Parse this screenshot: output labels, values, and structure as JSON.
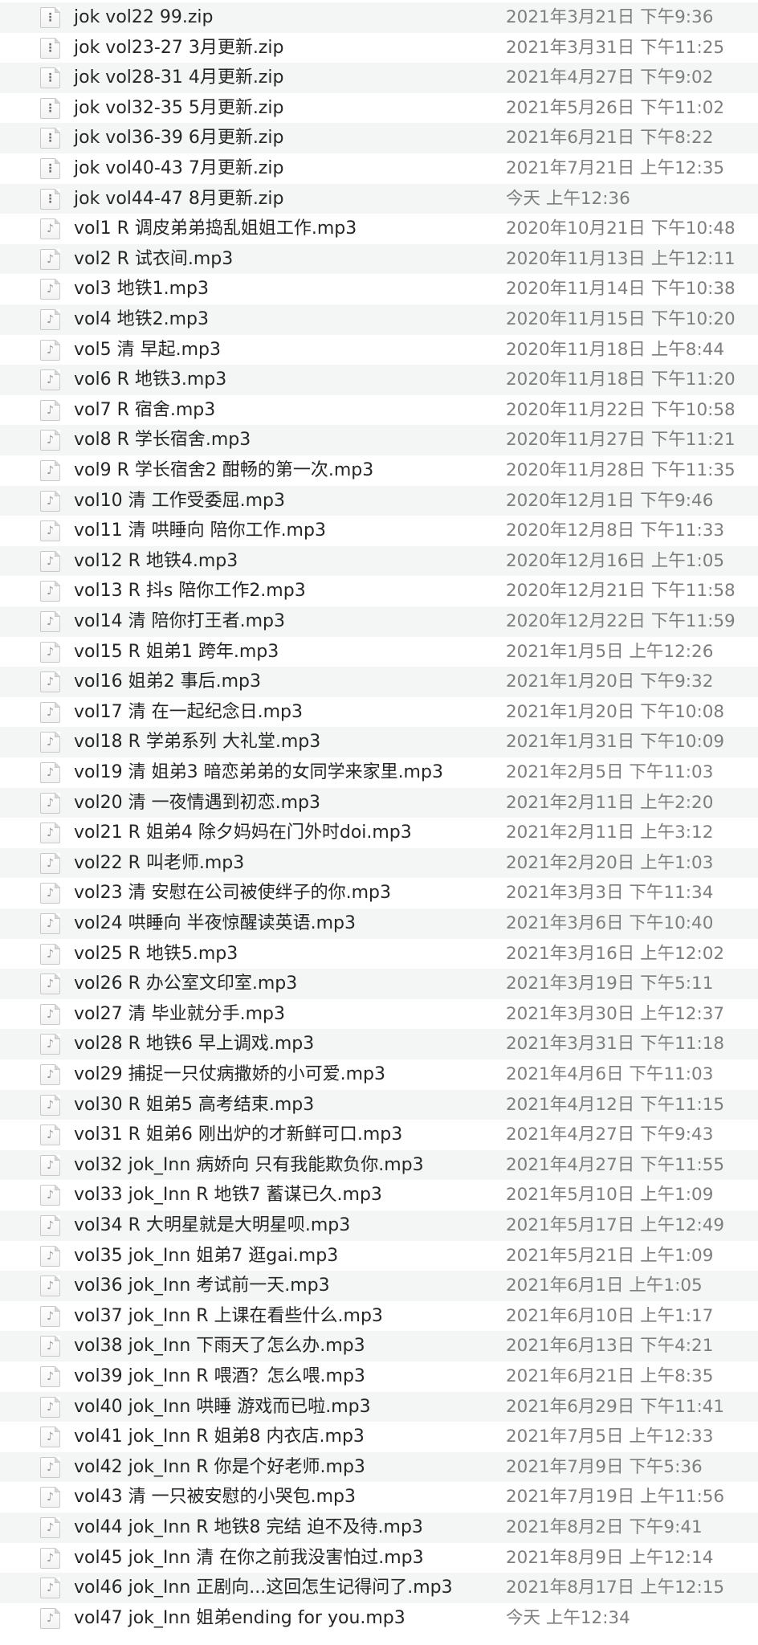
{
  "icons": {
    "zip": "zip-file-icon",
    "audio": "mp3-file-icon"
  },
  "files": [
    {
      "name": "jok vol22 99.zip",
      "date": "2021年3月21日 下午9:36",
      "type": "zip"
    },
    {
      "name": "jok vol23-27 3月更新.zip",
      "date": "2021年3月31日 下午11:25",
      "type": "zip"
    },
    {
      "name": "jok vol28-31 4月更新.zip",
      "date": "2021年4月27日 下午9:02",
      "type": "zip"
    },
    {
      "name": "jok vol32-35 5月更新.zip",
      "date": "2021年5月26日 下午11:02",
      "type": "zip"
    },
    {
      "name": "jok vol36-39 6月更新.zip",
      "date": "2021年6月21日 下午8:22",
      "type": "zip"
    },
    {
      "name": "jok vol40-43 7月更新.zip",
      "date": "2021年7月21日 上午12:35",
      "type": "zip"
    },
    {
      "name": "jok vol44-47 8月更新.zip",
      "date": "今天 上午12:36",
      "type": "zip"
    },
    {
      "name": "vol1 R 调皮弟弟捣乱姐姐工作.mp3",
      "date": "2020年10月21日 下午10:48",
      "type": "mp3"
    },
    {
      "name": "vol2 R 试衣间.mp3",
      "date": "2020年11月13日 上午12:11",
      "type": "mp3"
    },
    {
      "name": "vol3 地铁1.mp3",
      "date": "2020年11月14日 下午10:38",
      "type": "mp3"
    },
    {
      "name": "vol4 地铁2.mp3",
      "date": "2020年11月15日 下午10:20",
      "type": "mp3"
    },
    {
      "name": "vol5 清 早起.mp3",
      "date": "2020年11月18日 上午8:44",
      "type": "mp3"
    },
    {
      "name": "vol6 R 地铁3.mp3",
      "date": "2020年11月18日 下午11:20",
      "type": "mp3"
    },
    {
      "name": "vol7 R 宿舍.mp3",
      "date": "2020年11月22日 下午10:58",
      "type": "mp3"
    },
    {
      "name": "vol8 R 学长宿舍.mp3",
      "date": "2020年11月27日 下午11:21",
      "type": "mp3"
    },
    {
      "name": "vol9 R 学长宿舍2 酣畅的第一次.mp3",
      "date": "2020年11月28日 下午11:35",
      "type": "mp3"
    },
    {
      "name": "vol10 清 工作受委屈.mp3",
      "date": "2020年12月1日 下午9:46",
      "type": "mp3"
    },
    {
      "name": "vol11 清 哄睡向 陪你工作.mp3",
      "date": "2020年12月8日 下午11:33",
      "type": "mp3"
    },
    {
      "name": "vol12 R 地铁4.mp3",
      "date": "2020年12月16日 上午1:05",
      "type": "mp3"
    },
    {
      "name": "vol13 R 抖s 陪你工作2.mp3",
      "date": "2020年12月21日 下午11:58",
      "type": "mp3"
    },
    {
      "name": "vol14 清 陪你打王者.mp3",
      "date": "2020年12月22日 下午11:59",
      "type": "mp3"
    },
    {
      "name": "vol15 R 姐弟1 跨年.mp3",
      "date": "2021年1月5日 上午12:26",
      "type": "mp3"
    },
    {
      "name": "vol16 姐弟2 事后.mp3",
      "date": "2021年1月20日 下午9:32",
      "type": "mp3"
    },
    {
      "name": "vol17 清 在一起纪念日.mp3",
      "date": "2021年1月20日 下午10:08",
      "type": "mp3"
    },
    {
      "name": "vol18 R 学弟系列 大礼堂.mp3",
      "date": "2021年1月31日 下午10:09",
      "type": "mp3"
    },
    {
      "name": "vol19 清 姐弟3 暗恋弟弟的女同学来家里.mp3",
      "date": "2021年2月5日 下午11:03",
      "type": "mp3"
    },
    {
      "name": "vol20 清 一夜情遇到初恋.mp3",
      "date": "2021年2月11日 上午2:20",
      "type": "mp3"
    },
    {
      "name": "vol21 R 姐弟4 除夕妈妈在门外时doi.mp3",
      "date": "2021年2月11日 上午3:12",
      "type": "mp3"
    },
    {
      "name": "vol22 R 叫老师.mp3",
      "date": "2021年2月20日 上午1:03",
      "type": "mp3"
    },
    {
      "name": "vol23 清 安慰在公司被使绊子的你.mp3",
      "date": "2021年3月3日 下午11:34",
      "type": "mp3"
    },
    {
      "name": "vol24 哄睡向 半夜惊醒读英语.mp3",
      "date": "2021年3月6日 下午10:40",
      "type": "mp3"
    },
    {
      "name": "vol25 R 地铁5.mp3",
      "date": "2021年3月16日 上午12:02",
      "type": "mp3"
    },
    {
      "name": "vol26 R 办公室文印室.mp3",
      "date": "2021年3月19日 下午5:11",
      "type": "mp3"
    },
    {
      "name": "vol27 清 毕业就分手.mp3",
      "date": "2021年3月30日 上午12:37",
      "type": "mp3"
    },
    {
      "name": "vol28 R 地铁6 早上调戏.mp3",
      "date": "2021年3月31日 下午11:18",
      "type": "mp3"
    },
    {
      "name": "vol29 捕捉一只仗病撒娇的小可爱.mp3",
      "date": "2021年4月6日 下午11:03",
      "type": "mp3"
    },
    {
      "name": "vol30 R 姐弟5 高考结束.mp3",
      "date": "2021年4月12日 下午11:15",
      "type": "mp3"
    },
    {
      "name": "vol31 R 姐弟6 刚出炉的才新鲜可口.mp3",
      "date": "2021年4月27日 下午9:43",
      "type": "mp3"
    },
    {
      "name": "vol32 jok_Inn 病娇向 只有我能欺负你.mp3",
      "date": "2021年4月27日 下午11:55",
      "type": "mp3"
    },
    {
      "name": "vol33 jok_Inn R 地铁7 蓄谋已久.mp3",
      "date": "2021年5月10日 上午1:09",
      "type": "mp3"
    },
    {
      "name": "vol34 R 大明星就是大明星呗.mp3",
      "date": "2021年5月17日 上午12:49",
      "type": "mp3"
    },
    {
      "name": "vol35 jok_Inn 姐弟7 逛gai.mp3",
      "date": "2021年5月21日 上午1:09",
      "type": "mp3"
    },
    {
      "name": "vol36 jok_Inn 考试前一天.mp3",
      "date": "2021年6月1日 上午1:05",
      "type": "mp3"
    },
    {
      "name": "vol37 jok_Inn R 上课在看些什么.mp3",
      "date": "2021年6月10日 上午1:17",
      "type": "mp3"
    },
    {
      "name": "vol38 jok_Inn 下雨天了怎么办.mp3",
      "date": "2021年6月13日 下午4:21",
      "type": "mp3"
    },
    {
      "name": "vol39 jok_Inn R 喂酒？怎么喂.mp3",
      "date": "2021年6月21日 上午8:35",
      "type": "mp3"
    },
    {
      "name": "vol40 jok_Inn 哄睡 游戏而已啦.mp3",
      "date": "2021年6月29日 下午11:41",
      "type": "mp3"
    },
    {
      "name": "vol41 jok_Inn R 姐弟8 内衣店.mp3",
      "date": "2021年7月5日 上午12:33",
      "type": "mp3"
    },
    {
      "name": "vol42 jok_Inn R 你是个好老师.mp3",
      "date": "2021年7月9日 下午5:36",
      "type": "mp3"
    },
    {
      "name": "vol43 清 一只被安慰的小哭包.mp3",
      "date": "2021年7月19日 上午11:56",
      "type": "mp3"
    },
    {
      "name": "vol44 jok_Inn R 地铁8 完结 迫不及待.mp3",
      "date": "2021年8月2日 下午9:41",
      "type": "mp3"
    },
    {
      "name": "vol45 jok_Inn 清 在你之前我没害怕过.mp3",
      "date": "2021年8月9日 上午12:14",
      "type": "mp3"
    },
    {
      "name": "vol46 jok_Inn 正剧向...这回怎生记得问了.mp3",
      "date": "2021年8月17日 上午12:15",
      "type": "mp3"
    },
    {
      "name": "vol47 jok_Inn 姐弟ending for you.mp3",
      "date": "今天 上午12:34",
      "type": "mp3"
    }
  ]
}
